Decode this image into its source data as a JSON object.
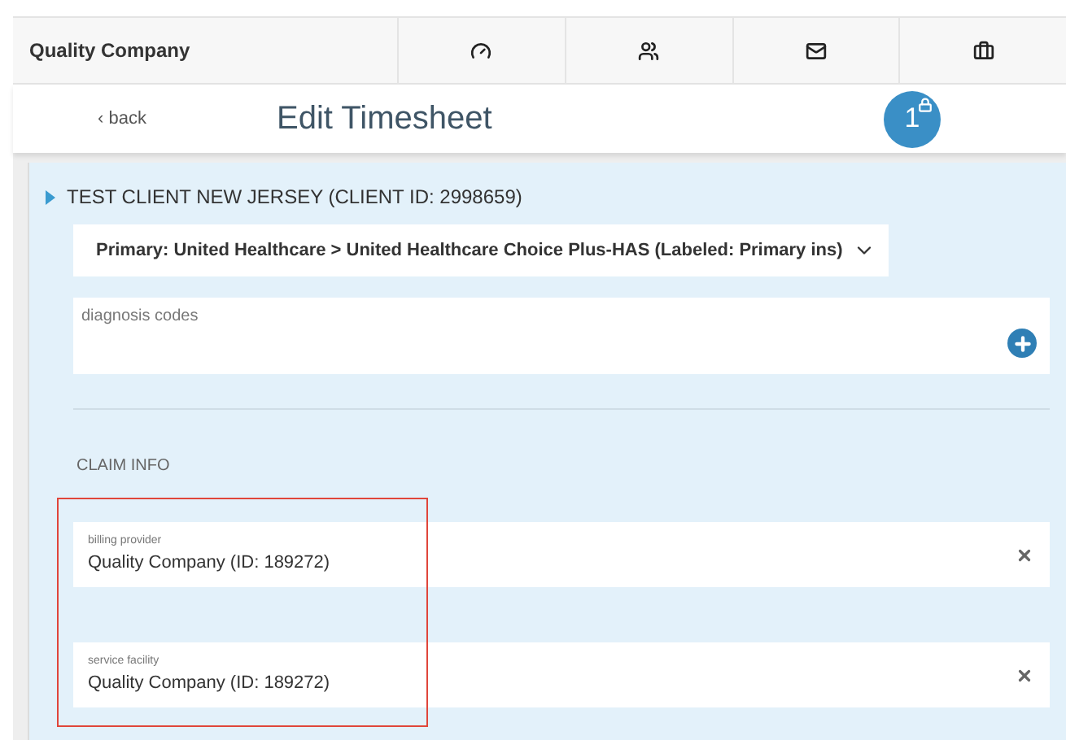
{
  "nav": {
    "company": "Quality Company"
  },
  "header": {
    "back": "‹ back",
    "title": "Edit Timesheet",
    "badge": "1",
    "badge_locked": true
  },
  "client": {
    "title": "TEST CLIENT NEW JERSEY (CLIENT ID: 2998659)",
    "expanded": false
  },
  "insurance_select": {
    "value": "Primary: United Healthcare > United Healthcare Choice Plus-HAS (Labeled: Primary ins)"
  },
  "diagnosis": {
    "placeholder": "diagnosis codes"
  },
  "claim_info": {
    "heading": "CLAIM INFO",
    "highlighted": true,
    "fields": [
      {
        "label": "billing provider",
        "value": "Quality Company (ID: 189272)"
      },
      {
        "label": "service facility",
        "value": "Quality Company (ID: 189272)"
      }
    ]
  }
}
